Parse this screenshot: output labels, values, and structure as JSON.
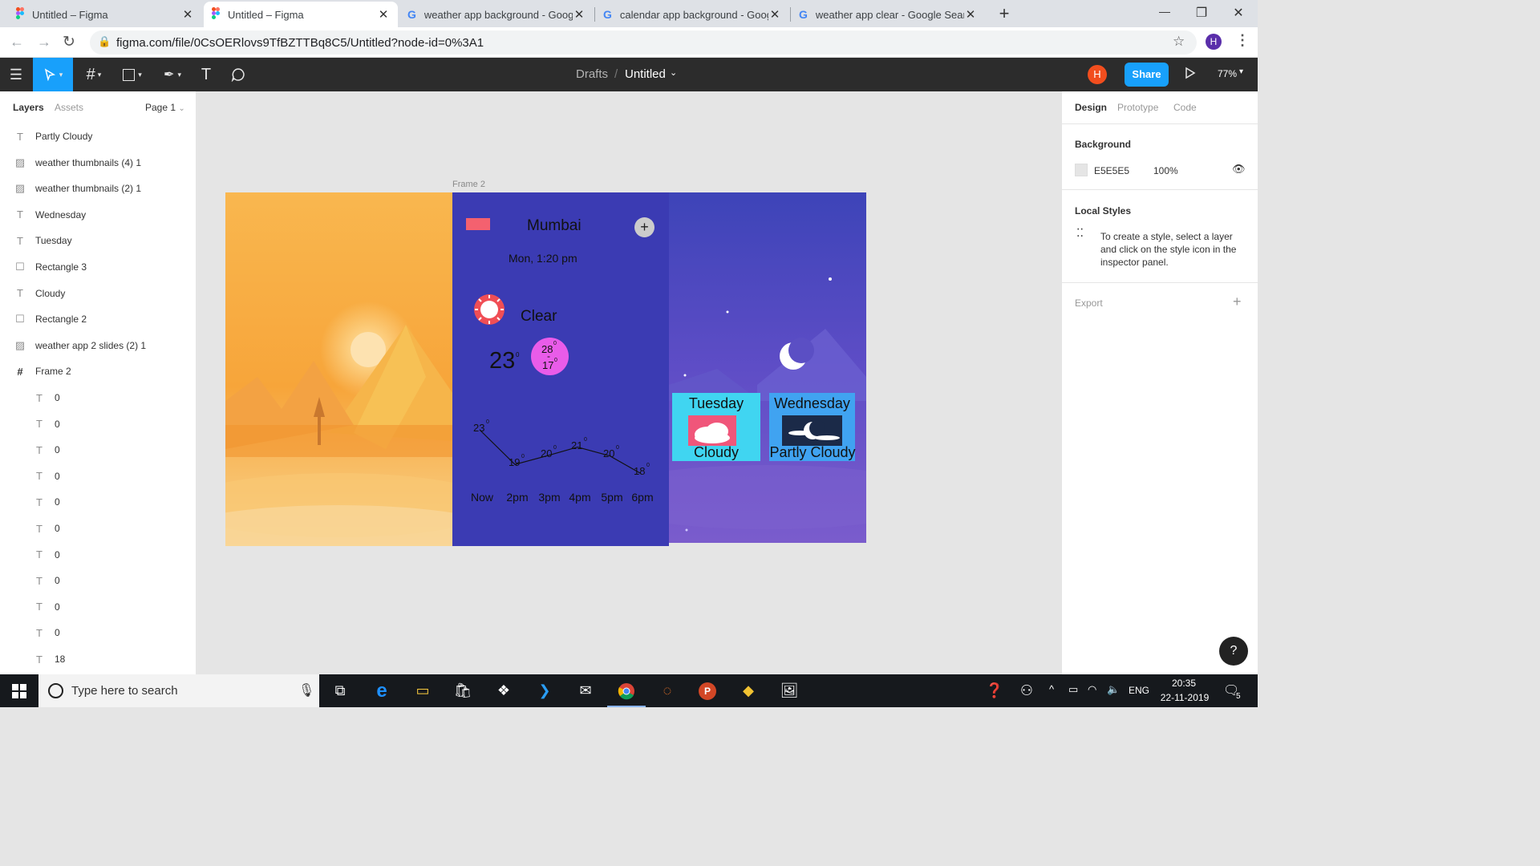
{
  "browser": {
    "tabs": [
      {
        "title": "Untitled – Figma"
      },
      {
        "title": "Untitled – Figma"
      },
      {
        "title": "weather app background - Goog"
      },
      {
        "title": "calendar app background - Goog"
      },
      {
        "title": "weather app clear - Google Searc"
      }
    ],
    "new_tab": "+",
    "url": "figma.com/file/0CsOERlovs9TfBZTTBq8C5/Untitled?node-id=0%3A1",
    "profile_initial": "H",
    "window": {
      "minimize": "—",
      "restore": "❐",
      "close": "✕"
    }
  },
  "toolbar": {
    "breadcrumb_root": "Drafts",
    "breadcrumb_sep": "/",
    "file_name": "Untitled",
    "user_initial": "H",
    "share_label": "Share",
    "zoom": "77%"
  },
  "left_panel": {
    "tabs": [
      "Layers",
      "Assets"
    ],
    "page": "Page 1",
    "layers": [
      {
        "icon": "T",
        "name": "Partly Cloudy"
      },
      {
        "icon": "img",
        "name": "weather thumbnails (4) 1"
      },
      {
        "icon": "img",
        "name": "weather thumbnails (2) 1"
      },
      {
        "icon": "T",
        "name": "Wednesday"
      },
      {
        "icon": "T",
        "name": "Tuesday"
      },
      {
        "icon": "rect",
        "name": "Rectangle 3"
      },
      {
        "icon": "T",
        "name": "Cloudy"
      },
      {
        "icon": "rect",
        "name": "Rectangle 2"
      },
      {
        "icon": "img",
        "name": "weather app 2 slides (2) 1"
      },
      {
        "icon": "frame",
        "name": "Frame 2"
      },
      {
        "icon": "T",
        "name": "0"
      },
      {
        "icon": "T",
        "name": "0"
      },
      {
        "icon": "T",
        "name": "0"
      },
      {
        "icon": "T",
        "name": "0"
      },
      {
        "icon": "T",
        "name": "0"
      },
      {
        "icon": "T",
        "name": "0"
      },
      {
        "icon": "T",
        "name": "0"
      },
      {
        "icon": "T",
        "name": "0"
      },
      {
        "icon": "T",
        "name": "0"
      },
      {
        "icon": "T",
        "name": "0"
      },
      {
        "icon": "T",
        "name": "18"
      }
    ]
  },
  "right_panel": {
    "tabs": [
      "Design",
      "Prototype",
      "Code"
    ],
    "background_title": "Background",
    "bg_hex": "E5E5E5",
    "bg_opacity": "100%",
    "local_styles_title": "Local Styles",
    "local_styles_hint": "To create a style, select a layer and click on the style icon in the inspector panel.",
    "export_title": "Export",
    "help": "?"
  },
  "canvas": {
    "frame_label": "Frame 2",
    "weather": {
      "city": "Mumbai",
      "datetime": "Mon, 1:20  pm",
      "condition": "Clear",
      "temp": "23",
      "high": "28",
      "low": "17",
      "deg": "0",
      "minus": "-",
      "hourly": [
        {
          "time": "Now",
          "temp": "23"
        },
        {
          "time": "2pm",
          "temp": "19"
        },
        {
          "time": "3pm",
          "temp": "20"
        },
        {
          "time": "4pm",
          "temp": "21"
        },
        {
          "time": "5pm",
          "temp": "20"
        },
        {
          "time": "6pm",
          "temp": "18"
        }
      ]
    },
    "cards": [
      {
        "day": "Tuesday",
        "desc": "Cloudy"
      },
      {
        "day": "Wednesday",
        "desc": "Partly Cloudy"
      }
    ]
  },
  "taskbar": {
    "search_placeholder": "Type here to search",
    "lang": "ENG",
    "time": "20:35",
    "date": "22-11-2019",
    "notif_count": "5"
  }
}
